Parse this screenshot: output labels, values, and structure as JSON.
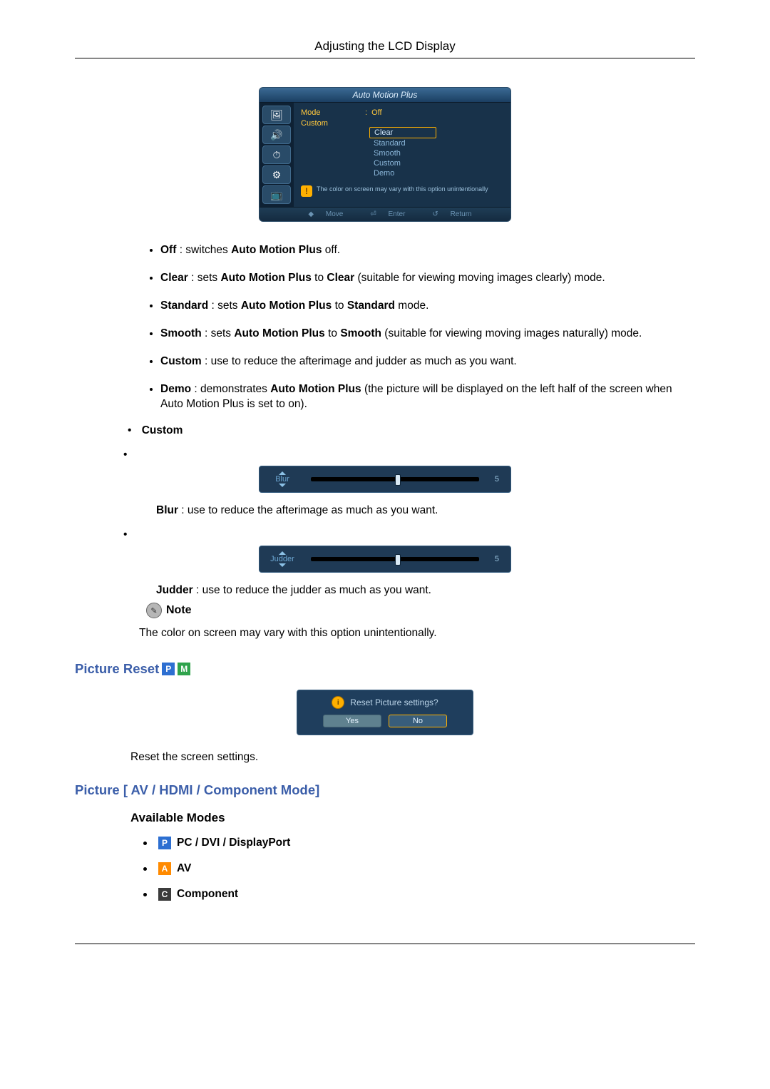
{
  "header": {
    "title": "Adjusting the LCD Display"
  },
  "osd": {
    "title": "Auto Motion Plus",
    "mode_label": "Mode",
    "custom_label": "Custom",
    "options": {
      "off": "Off",
      "clear": "Clear",
      "standard": "Standard",
      "smooth": "Smooth",
      "custom": "Custom",
      "demo": "Demo"
    },
    "notice": "The color on screen may vary with this option unintentionally",
    "footer": {
      "move": "Move",
      "enter": "Enter",
      "return": "Return"
    }
  },
  "bullets": {
    "off": {
      "label": "Off",
      "text": " : switches ",
      "bold2": "Auto Motion Plus",
      "text2": " off."
    },
    "clear": {
      "label": "Clear",
      "text": " : sets ",
      "bold2": "Auto Motion Plus",
      "text2": " to ",
      "bold3": "Clear",
      "text3": " (suitable for viewing moving images clearly) mode."
    },
    "standard": {
      "label": "Standard",
      "text": " : sets ",
      "bold2": "Auto Motion Plus",
      "text2": " to ",
      "bold3": "Standard",
      "text3": " mode."
    },
    "smooth": {
      "label": "Smooth",
      "text": " : sets  ",
      "bold2": "Auto Motion Plus",
      "text2": "  to  ",
      "bold3": "Smooth",
      "text3": " (suitable for viewing moving images naturally) mode."
    },
    "custom": {
      "label": "Custom",
      "text": " : use to reduce the afterimage and judder as much as you want."
    },
    "demo": {
      "label": "Demo",
      "text": " : demonstrates ",
      "bold2": "Auto Motion Plus",
      "text2": " (the picture will be displayed on the left half of the screen when Auto Motion Plus is set to on)."
    }
  },
  "custom_section": {
    "label": "Custom",
    "blur": {
      "name": "Blur",
      "value": "5",
      "thumb_pct": 50,
      "desc_bold": "Blur",
      "desc": " : use to reduce the afterimage as much as you want."
    },
    "judder": {
      "name": "Judder",
      "value": "5",
      "thumb_pct": 50,
      "desc_bold": "Judder",
      "desc": " : use to reduce the judder as much as you want."
    },
    "note_label": "Note",
    "note_text": "The color on screen may vary with this option unintentionally."
  },
  "picture_reset": {
    "heading": "Picture Reset",
    "badges": {
      "p": "P",
      "m": "M"
    },
    "dialog_title": "Reset Picture settings?",
    "yes": "Yes",
    "no": "No",
    "desc": "Reset the screen settings."
  },
  "picture_modes": {
    "heading": "Picture [ AV / HDMI / Component Mode]",
    "sub": "Available Modes",
    "items": {
      "pc": {
        "badge": "P",
        "label": "PC / DVI / DisplayPort"
      },
      "av": {
        "badge": "A",
        "label": "AV"
      },
      "component": {
        "badge": "C",
        "label": "Component"
      }
    }
  }
}
